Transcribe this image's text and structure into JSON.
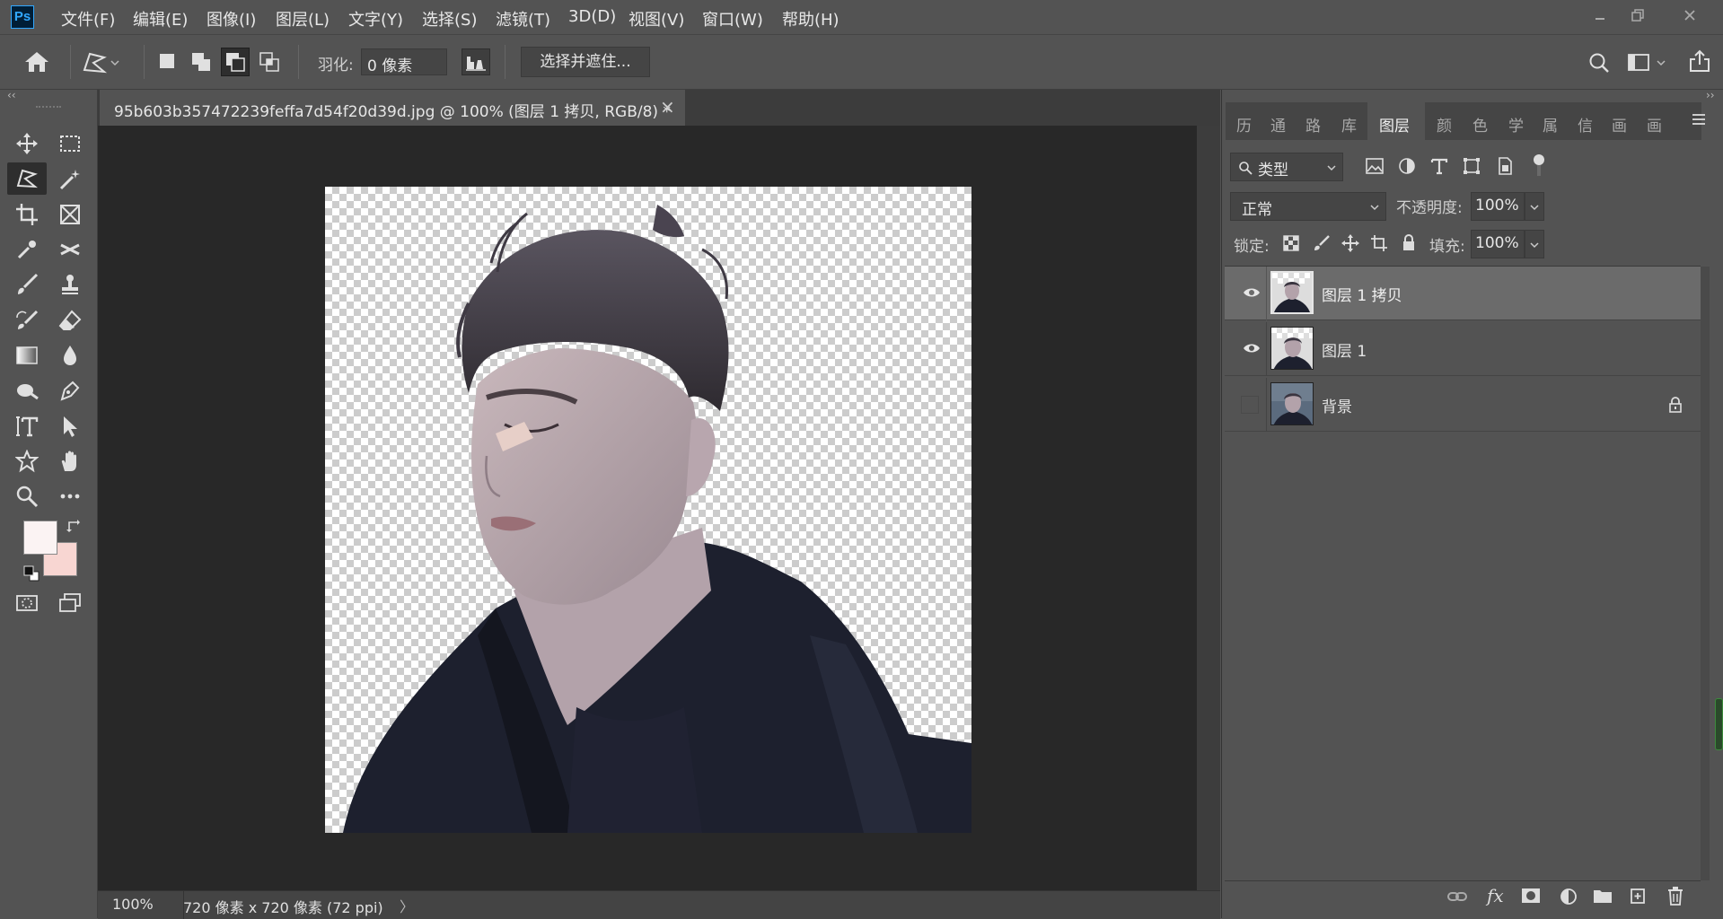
{
  "app": {
    "logo": "Ps"
  },
  "menu": [
    "文件(F)",
    "编辑(E)",
    "图像(I)",
    "图层(L)",
    "文字(Y)",
    "选择(S)",
    "滤镜(T)",
    "3D(D)",
    "视图(V)",
    "窗口(W)",
    "帮助(H)"
  ],
  "options": {
    "feather_label": "羽化:",
    "feather_value": "0 像素",
    "select_mask_button": "选择并遮住..."
  },
  "document": {
    "tab_title": "95b603b357472239feffa7d54f20d39d.jpg @ 100% (图层 1 拷贝, RGB/8) *",
    "close_glyph": "×"
  },
  "status": {
    "zoom": "100%",
    "doc_info": "720 像素 x 720 像素 (72 ppi)",
    "arrow": "〉"
  },
  "panel_tabs": [
    "历",
    "通",
    "路",
    "库",
    "图层",
    "颜",
    "色",
    "学",
    "属",
    "信",
    "画",
    "画"
  ],
  "panel_active_tab": "图层",
  "layers_panel": {
    "filter_label": "类型",
    "blend_mode": "正常",
    "opacity_label": "不透明度:",
    "opacity_value": "100%",
    "lock_label": "锁定:",
    "fill_label": "填充:",
    "fill_value": "100%",
    "layers": [
      {
        "name": "图层 1 拷贝",
        "visible": true,
        "selected": true,
        "locked": false
      },
      {
        "name": "图层 1",
        "visible": true,
        "selected": false,
        "locked": false
      },
      {
        "name": "背景",
        "visible": false,
        "selected": false,
        "locked": true
      }
    ]
  },
  "colors": {
    "foreground": "#fbf3f3",
    "background": "#f8d6d2",
    "accent": "#31a8ff"
  },
  "icons": {
    "toolbar": [
      "move",
      "marquee",
      "lasso",
      "magic-wand",
      "crop",
      "frame",
      "eyedropper",
      "healing",
      "brush",
      "stamp",
      "history-brush",
      "eraser",
      "gradient",
      "blur",
      "dodge",
      "pen",
      "type",
      "path-select",
      "shape",
      "hand",
      "zoom",
      "more"
    ]
  }
}
